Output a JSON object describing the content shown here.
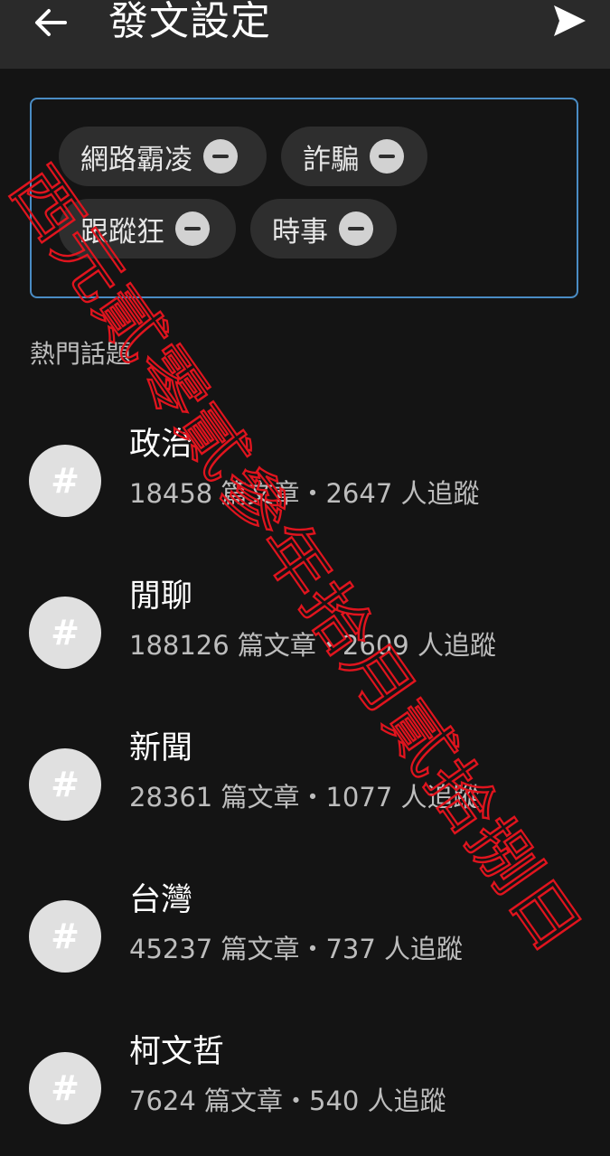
{
  "app_bar": {
    "title": "發文設定",
    "back_icon": "arrow-left-icon",
    "send_icon": "send-icon"
  },
  "selected_topics": [
    {
      "label": "網路霸凌",
      "remove_icon": "minus-circle-icon"
    },
    {
      "label": "詐騙",
      "remove_icon": "minus-circle-icon"
    },
    {
      "label": "跟蹤狂",
      "remove_icon": "minus-circle-icon"
    },
    {
      "label": "時事",
      "remove_icon": "minus-circle-icon"
    }
  ],
  "hot_topics": {
    "heading": "熱門話題",
    "items": [
      {
        "icon": "#",
        "name": "政治",
        "stats": "18458 篇文章・2647 人追蹤"
      },
      {
        "icon": "#",
        "name": "閒聊",
        "stats": "188126 篇文章・2609 人追蹤"
      },
      {
        "icon": "#",
        "name": "新聞",
        "stats": "28361 篇文章・1077 人追蹤"
      },
      {
        "icon": "#",
        "name": "台灣",
        "stats": "45237 篇文章・737 人追蹤"
      },
      {
        "icon": "#",
        "name": "柯文哲",
        "stats": "7624 篇文章・540 人追蹤"
      }
    ]
  },
  "watermark": {
    "text": "西元貳零貳參年拾月貳拾捌日",
    "color": "#e0141e"
  },
  "colors": {
    "background": "#141414",
    "app_bar": "#2a2a2a",
    "chip_box_border": "#4a8cc4",
    "chip_background": "#2e2e2e"
  }
}
